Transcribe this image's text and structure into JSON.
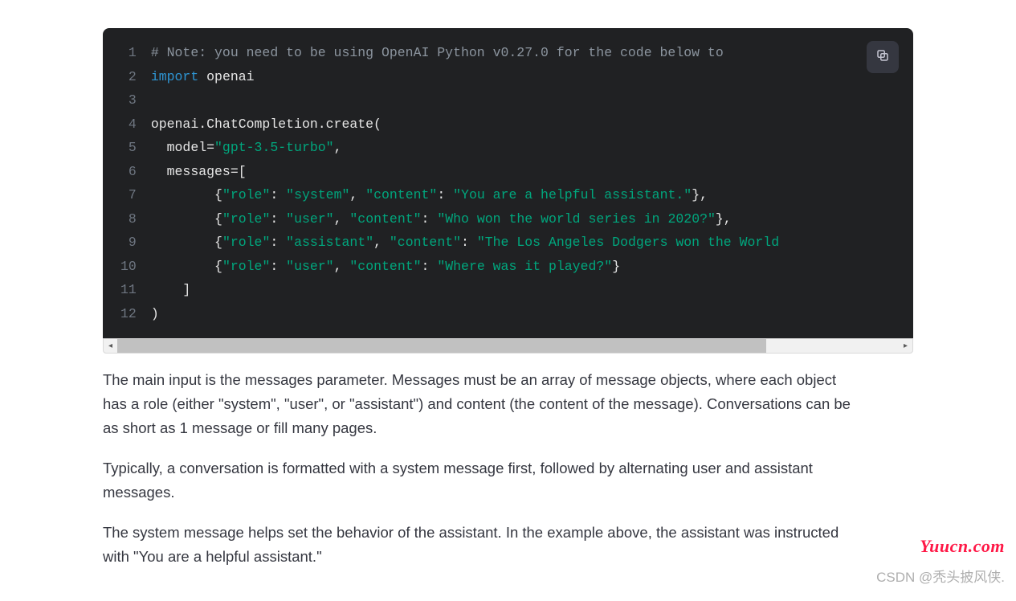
{
  "code": {
    "line_numbers": [
      "1",
      "2",
      "3",
      "4",
      "5",
      "6",
      "7",
      "8",
      "9",
      "10",
      "11",
      "12"
    ],
    "tokens": [
      [
        {
          "cls": "c-comment",
          "t": "# Note: you need to be using OpenAI Python v0.27.0 for the code below to "
        }
      ],
      [
        {
          "cls": "c-keyword",
          "t": "import"
        },
        {
          "cls": "c-plain",
          "t": " openai"
        }
      ],
      [
        {
          "cls": "c-plain",
          "t": ""
        }
      ],
      [
        {
          "cls": "c-plain",
          "t": "openai.ChatCompletion.create("
        }
      ],
      [
        {
          "cls": "c-plain",
          "t": "  model="
        },
        {
          "cls": "c-string",
          "t": "\"gpt-3.5-turbo\""
        },
        {
          "cls": "c-plain",
          "t": ","
        }
      ],
      [
        {
          "cls": "c-plain",
          "t": "  messages=["
        }
      ],
      [
        {
          "cls": "c-plain",
          "t": "        {"
        },
        {
          "cls": "c-string",
          "t": "\"role\""
        },
        {
          "cls": "c-plain",
          "t": ": "
        },
        {
          "cls": "c-string",
          "t": "\"system\""
        },
        {
          "cls": "c-plain",
          "t": ", "
        },
        {
          "cls": "c-string",
          "t": "\"content\""
        },
        {
          "cls": "c-plain",
          "t": ": "
        },
        {
          "cls": "c-string",
          "t": "\"You are a helpful assistant.\""
        },
        {
          "cls": "c-plain",
          "t": "},"
        }
      ],
      [
        {
          "cls": "c-plain",
          "t": "        {"
        },
        {
          "cls": "c-string",
          "t": "\"role\""
        },
        {
          "cls": "c-plain",
          "t": ": "
        },
        {
          "cls": "c-string",
          "t": "\"user\""
        },
        {
          "cls": "c-plain",
          "t": ", "
        },
        {
          "cls": "c-string",
          "t": "\"content\""
        },
        {
          "cls": "c-plain",
          "t": ": "
        },
        {
          "cls": "c-string",
          "t": "\"Who won the world series in 2020?\""
        },
        {
          "cls": "c-plain",
          "t": "},"
        }
      ],
      [
        {
          "cls": "c-plain",
          "t": "        {"
        },
        {
          "cls": "c-string",
          "t": "\"role\""
        },
        {
          "cls": "c-plain",
          "t": ": "
        },
        {
          "cls": "c-string",
          "t": "\"assistant\""
        },
        {
          "cls": "c-plain",
          "t": ", "
        },
        {
          "cls": "c-string",
          "t": "\"content\""
        },
        {
          "cls": "c-plain",
          "t": ": "
        },
        {
          "cls": "c-string",
          "t": "\"The Los Angeles Dodgers won the World"
        }
      ],
      [
        {
          "cls": "c-plain",
          "t": "        {"
        },
        {
          "cls": "c-string",
          "t": "\"role\""
        },
        {
          "cls": "c-plain",
          "t": ": "
        },
        {
          "cls": "c-string",
          "t": "\"user\""
        },
        {
          "cls": "c-plain",
          "t": ", "
        },
        {
          "cls": "c-string",
          "t": "\"content\""
        },
        {
          "cls": "c-plain",
          "t": ": "
        },
        {
          "cls": "c-string",
          "t": "\"Where was it played?\""
        },
        {
          "cls": "c-plain",
          "t": "}"
        }
      ],
      [
        {
          "cls": "c-plain",
          "t": "    ]"
        }
      ],
      [
        {
          "cls": "c-plain",
          "t": ")"
        }
      ]
    ]
  },
  "paragraphs": {
    "p1": "The main input is the messages parameter. Messages must be an array of message objects, where each object has a role (either \"system\", \"user\", or \"assistant\") and content (the content of the message). Conversations can be as short as 1 message or fill many pages.",
    "p2": "Typically, a conversation is formatted with a system message first, followed by alternating user and assistant messages.",
    "p3": "The system message helps set the behavior of the assistant. In the example above, the assistant was instructed with \"You are a helpful assistant.\""
  },
  "watermarks": {
    "site": "Yuucn.com",
    "csdn": "CSDN @秃头披风侠."
  }
}
